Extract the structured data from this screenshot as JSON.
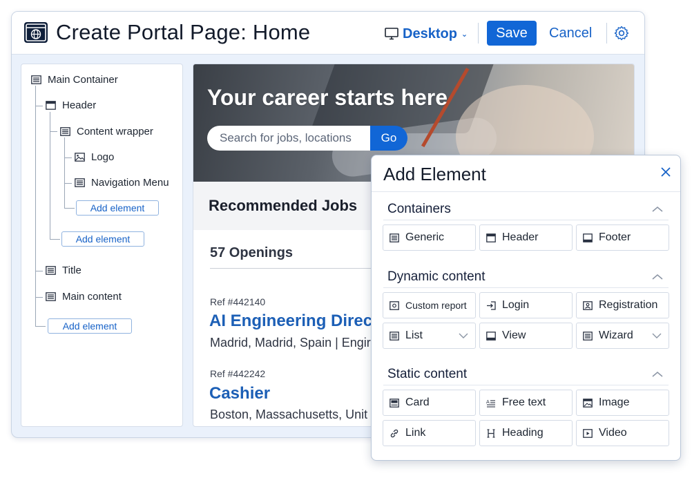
{
  "header": {
    "title": "Create Portal Page: Home",
    "device": "Desktop",
    "save_label": "Save",
    "cancel_label": "Cancel"
  },
  "tree": {
    "nodes": [
      "Main Container",
      "Header",
      "Content wrapper",
      "Logo",
      "Navigation Menu",
      "Title",
      "Main content"
    ],
    "add_element_label": "Add element"
  },
  "preview": {
    "hero_title": "Your career starts here",
    "search_placeholder": "Search for jobs, locations",
    "go_label": "Go",
    "recommended_title": "Recommended Jobs",
    "openings": "57 Openings",
    "jobs": [
      {
        "ref": "Ref #442140",
        "title": "AI Engineering Direc",
        "location": "Madrid, Madrid, Spain | Engir"
      },
      {
        "ref": "Ref #442242",
        "title": "Cashier",
        "location": "Boston, Massachusetts, Unit"
      }
    ]
  },
  "add_element": {
    "title": "Add Element",
    "sections": [
      {
        "title": "Containers",
        "items": [
          "Generic",
          "Header",
          "Footer"
        ]
      },
      {
        "title": "Dynamic content",
        "items": [
          "Custom report",
          "Login",
          "Registration",
          "List",
          "View",
          "Wizard"
        ]
      },
      {
        "title": "Static content",
        "items": [
          "Card",
          "Free text",
          "Image",
          "Link",
          "Heading",
          "Video"
        ]
      }
    ]
  },
  "colors": {
    "accent": "#1166d6",
    "link": "#1762c7",
    "job_title": "#1c5fb6",
    "app_icon": "#0f1f3a"
  }
}
